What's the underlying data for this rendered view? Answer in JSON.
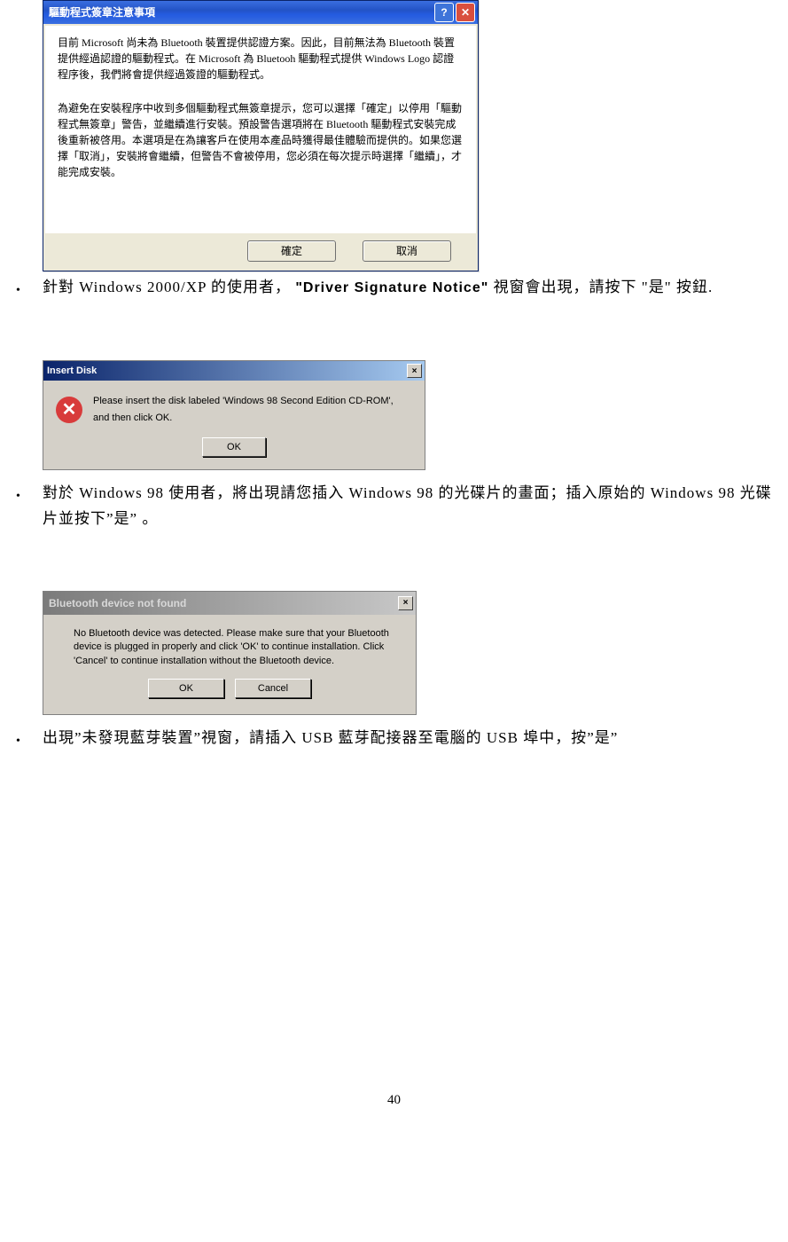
{
  "dialog1": {
    "title": "驅動程式簽章注意事項",
    "para1": "目前 Microsoft 尚未為 Bluetooth 裝置提供認證方案。因此，目前無法為 Bluetooth 裝置提供經過認證的驅動程式。在 Microsoft 為 Bluetooh 驅動程式提供 Windows Logo 認證程序後，我們將會提供經過簽證的驅動程式。",
    "para2": "為避免在安裝程序中收到多個驅動程式無簽章提示，您可以選擇「確定」以停用「驅動程式無簽章」警告，並繼續進行安裝。預設警告選項將在 Bluetooth 驅動程式安裝完成後重新被啓用。本選項是在為讓客戶在使用本產品時獲得最佳體驗而提供的。如果您選擇「取消」，安裝將會繼續，但警告不會被停用，您必須在每次提示時選擇「繼續」，才能完成安裝。",
    "ok": "確定",
    "cancel": "取消"
  },
  "bullet1": {
    "pre": "針對 Windows 2000/XP 的使用者， ",
    "bold": "\"Driver Signature Notice\"",
    "post": " 視窗會出現，請按下 \"是\"  按鈕."
  },
  "dialog2": {
    "title": "Insert Disk",
    "message": "Please insert the disk labeled 'Windows 98 Second Edition CD-ROM', and then click OK.",
    "ok": "OK"
  },
  "bullet2": "對於 Windows 98 使用者，將出現請您插入 Windows 98 的光碟片的畫面；插入原始的 Windows 98 光碟片並按下”是” 。",
  "dialog3": {
    "title": "Bluetooth device not found",
    "message": "No Bluetooth device was detected. Please make sure that your Bluetooth device is plugged in properly and click 'OK' to continue installation. Click 'Cancel' to continue installation without the Bluetooth device.",
    "ok": "OK",
    "cancel": "Cancel"
  },
  "bullet3": "出現”未發現藍芽裝置”視窗，請插入 USB 藍芽配接器至電腦的 USB 埠中，按”是”",
  "page_number": "40"
}
